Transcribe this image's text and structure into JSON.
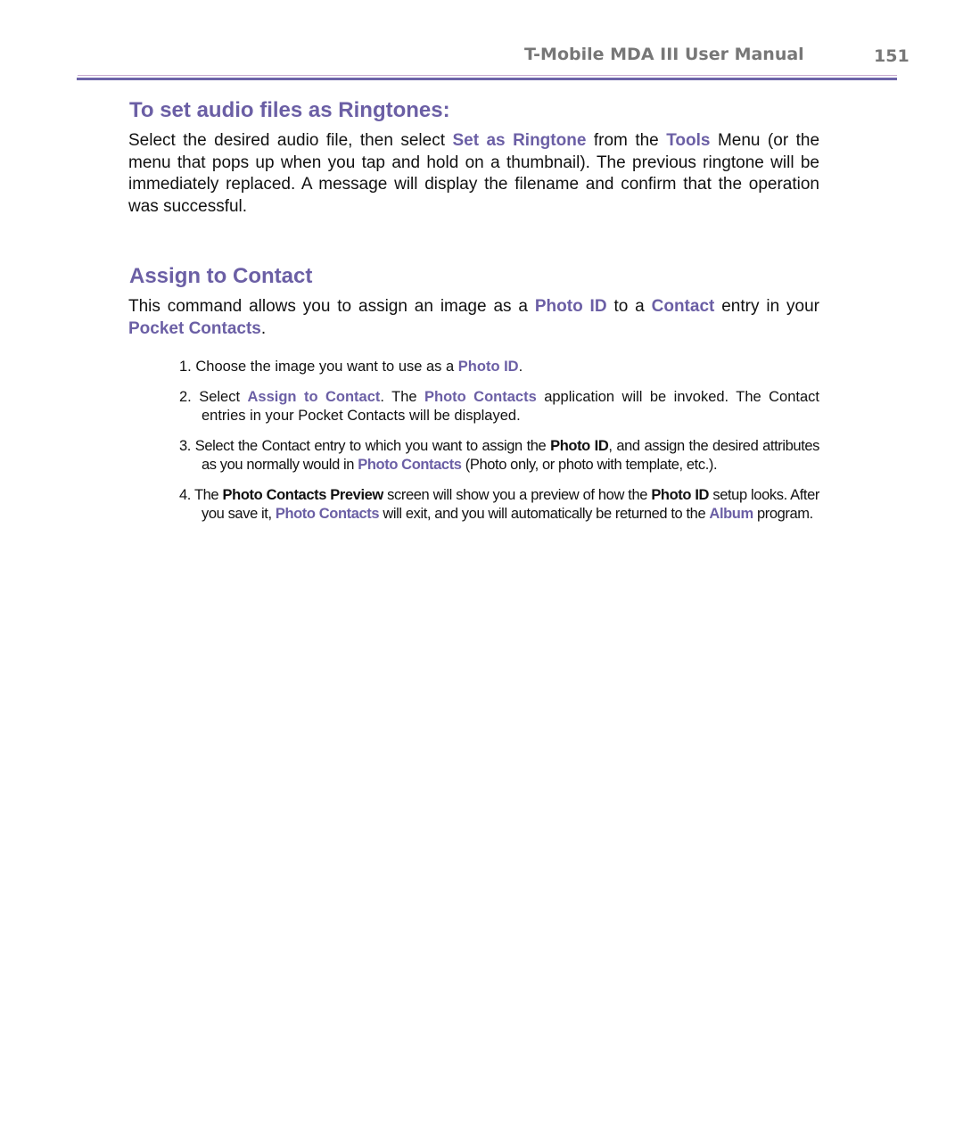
{
  "header": {
    "title": "T-Mobile MDA III User Manual",
    "page_number": "151",
    "colors": {
      "text": "#777777",
      "rule_thin": "#c7a9cf",
      "rule_thick": "#6c64a8"
    }
  },
  "accent_color": "#6b5fa5",
  "section1": {
    "heading": "To set audio files as Ringtones:",
    "para": {
      "t1": "Select the desired audio file, then select ",
      "l1": "Set as Ringtone",
      "t2": " from the ",
      "l2": "Tools",
      "t3": " Menu (or the menu that pops up when you tap and hold on a thumbnail). The previous ringtone will be immediately replaced. A message will display the filename and confirm that the operation was successful."
    }
  },
  "section2": {
    "heading": "Assign to Contact",
    "para": {
      "t1": "This command allows you to assign an image as a ",
      "l1": "Photo ID",
      "t2": " to a ",
      "l2": "Contact",
      "t3": " entry in your ",
      "l3": "Pocket Contacts",
      "t4": "."
    },
    "steps": [
      {
        "num": "1.",
        "t1": " Choose the image you want to use as a ",
        "l1": "Photo ID",
        "t2": "."
      },
      {
        "num": "2.",
        "t1": " Select ",
        "l1": "Assign to Contact",
        "t2": ".  The ",
        "l2": "Photo Contacts",
        "t3": " application will be invoked.  The Contact entries in your Pocket Contacts will be displayed."
      },
      {
        "num": "3.",
        "t1": " Select the Contact entry to which you want to assign the ",
        "b1": "Photo ID",
        "t2": ", and assign the desired attributes as you normally would in ",
        "l1": "Photo Contacts",
        "t3": " (Photo only, or photo with template, etc.)."
      },
      {
        "num": "4.",
        "t1": " The ",
        "b1": "Photo Contacts Preview",
        "t2": " screen will show you a preview of how the ",
        "b2": "Photo ID",
        "t3": " setup looks.  After you save it, ",
        "l1": "Photo Contacts",
        "t4": " will exit, and you will automatically be returned to the ",
        "l2": "Album",
        "t5": " program."
      }
    ]
  }
}
